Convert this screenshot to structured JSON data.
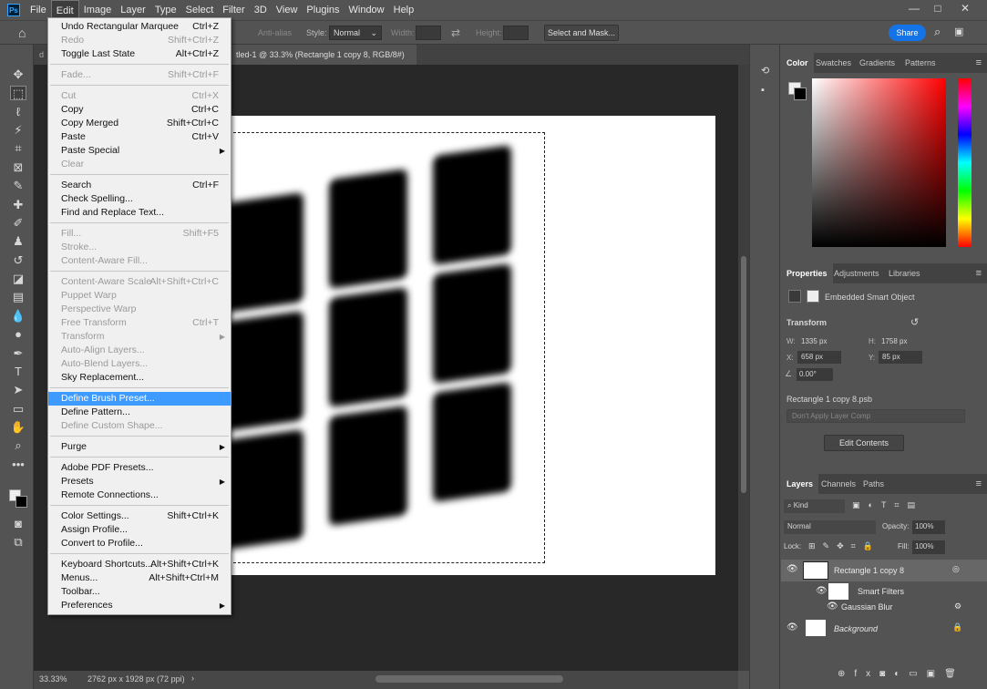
{
  "menubar": {
    "logo": "Ps",
    "items": [
      "File",
      "Edit",
      "Image",
      "Layer",
      "Type",
      "Select",
      "Filter",
      "3D",
      "View",
      "Plugins",
      "Window",
      "Help"
    ]
  },
  "window_controls": {
    "minimize": "—",
    "restore": "□",
    "close": "✕"
  },
  "optionsbar": {
    "antialias": "Anti-alias",
    "style_label": "Style:",
    "style_value": "Normal",
    "width_label": "Width:",
    "height_label": "Height:",
    "select_mask": "Select and Mask...",
    "share": "Share"
  },
  "tabs": {
    "left_tab": "d",
    "doc_tab": "tled-1 @ 33.3% (Rectangle 1 copy 8, RGB/8#) *",
    "close": "×"
  },
  "status": {
    "zoom": "33.33%",
    "size": "2762 px x 1928 px (72 ppi)",
    "arrow": "›"
  },
  "edit_menu": [
    {
      "label": "Undo Rectangular Marquee",
      "shortcut": "Ctrl+Z",
      "disabled": false
    },
    {
      "label": "Redo",
      "shortcut": "Shift+Ctrl+Z",
      "disabled": true
    },
    {
      "label": "Toggle Last State",
      "shortcut": "Alt+Ctrl+Z",
      "disabled": false
    },
    {
      "sep": true
    },
    {
      "label": "Fade...",
      "shortcut": "Shift+Ctrl+F",
      "disabled": true
    },
    {
      "sep": true
    },
    {
      "label": "Cut",
      "shortcut": "Ctrl+X",
      "disabled": true
    },
    {
      "label": "Copy",
      "shortcut": "Ctrl+C",
      "disabled": false
    },
    {
      "label": "Copy Merged",
      "shortcut": "Shift+Ctrl+C",
      "disabled": false
    },
    {
      "label": "Paste",
      "shortcut": "Ctrl+V",
      "disabled": false
    },
    {
      "label": "Paste Special",
      "shortcut": "",
      "disabled": false,
      "submenu": true
    },
    {
      "label": "Clear",
      "shortcut": "",
      "disabled": true
    },
    {
      "sep": true
    },
    {
      "label": "Search",
      "shortcut": "Ctrl+F",
      "disabled": false
    },
    {
      "label": "Check Spelling...",
      "shortcut": "",
      "disabled": false
    },
    {
      "label": "Find and Replace Text...",
      "shortcut": "",
      "disabled": false
    },
    {
      "sep": true
    },
    {
      "label": "Fill...",
      "shortcut": "Shift+F5",
      "disabled": true
    },
    {
      "label": "Stroke...",
      "shortcut": "",
      "disabled": true
    },
    {
      "label": "Content-Aware Fill...",
      "shortcut": "",
      "disabled": true
    },
    {
      "sep": true
    },
    {
      "label": "Content-Aware Scale",
      "shortcut": "Alt+Shift+Ctrl+C",
      "disabled": true
    },
    {
      "label": "Puppet Warp",
      "shortcut": "",
      "disabled": true
    },
    {
      "label": "Perspective Warp",
      "shortcut": "",
      "disabled": true
    },
    {
      "label": "Free Transform",
      "shortcut": "Ctrl+T",
      "disabled": true
    },
    {
      "label": "Transform",
      "shortcut": "",
      "disabled": true,
      "submenu": true
    },
    {
      "label": "Auto-Align Layers...",
      "shortcut": "",
      "disabled": true
    },
    {
      "label": "Auto-Blend Layers...",
      "shortcut": "",
      "disabled": true
    },
    {
      "label": "Sky Replacement...",
      "shortcut": "",
      "disabled": false
    },
    {
      "sep": true
    },
    {
      "label": "Define Brush Preset...",
      "shortcut": "",
      "disabled": false,
      "selected": true
    },
    {
      "label": "Define Pattern...",
      "shortcut": "",
      "disabled": false
    },
    {
      "label": "Define Custom Shape...",
      "shortcut": "",
      "disabled": true
    },
    {
      "sep": true
    },
    {
      "label": "Purge",
      "shortcut": "",
      "disabled": false,
      "submenu": true
    },
    {
      "sep": true
    },
    {
      "label": "Adobe PDF Presets...",
      "shortcut": "",
      "disabled": false
    },
    {
      "label": "Presets",
      "shortcut": "",
      "disabled": false,
      "submenu": true
    },
    {
      "label": "Remote Connections...",
      "shortcut": "",
      "disabled": false
    },
    {
      "sep": true
    },
    {
      "label": "Color Settings...",
      "shortcut": "Shift+Ctrl+K",
      "disabled": false
    },
    {
      "label": "Assign Profile...",
      "shortcut": "",
      "disabled": false
    },
    {
      "label": "Convert to Profile...",
      "shortcut": "",
      "disabled": false
    },
    {
      "sep": true
    },
    {
      "label": "Keyboard Shortcuts...",
      "shortcut": "Alt+Shift+Ctrl+K",
      "disabled": false
    },
    {
      "label": "Menus...",
      "shortcut": "Alt+Shift+Ctrl+M",
      "disabled": false
    },
    {
      "label": "Toolbar...",
      "shortcut": "",
      "disabled": false
    },
    {
      "label": "Preferences",
      "shortcut": "",
      "disabled": false,
      "submenu": true
    }
  ],
  "color_panel": {
    "tabs": [
      "Color",
      "Swatches",
      "Gradients",
      "Patterns"
    ]
  },
  "properties_panel": {
    "tabs": [
      "Properties",
      "Adjustments",
      "Libraries"
    ],
    "object_type": "Embedded Smart Object",
    "transform_label": "Transform",
    "w_label": "W:",
    "w_value": "1335 px",
    "h_label": "H:",
    "h_value": "1758 px",
    "x_label": "X:",
    "x_value": "658 px",
    "y_label": "Y:",
    "y_value": "85 px",
    "angle_value": "0.00°",
    "filename": "Rectangle 1 copy 8.psb",
    "layer_comp": "Don't Apply Layer Comp",
    "edit_contents": "Edit Contents"
  },
  "layers_panel": {
    "tabs": [
      "Layers",
      "Channels",
      "Paths"
    ],
    "kind": "Kind",
    "blend": "Normal",
    "opacity_label": "Opacity:",
    "opacity_value": "100%",
    "lock_label": "Lock:",
    "fill_label": "Fill:",
    "fill_value": "100%",
    "layers": [
      {
        "name": "Rectangle 1 copy 8"
      },
      {
        "name": "Smart Filters"
      },
      {
        "name": "Gaussian Blur"
      },
      {
        "name": "Background"
      }
    ]
  }
}
